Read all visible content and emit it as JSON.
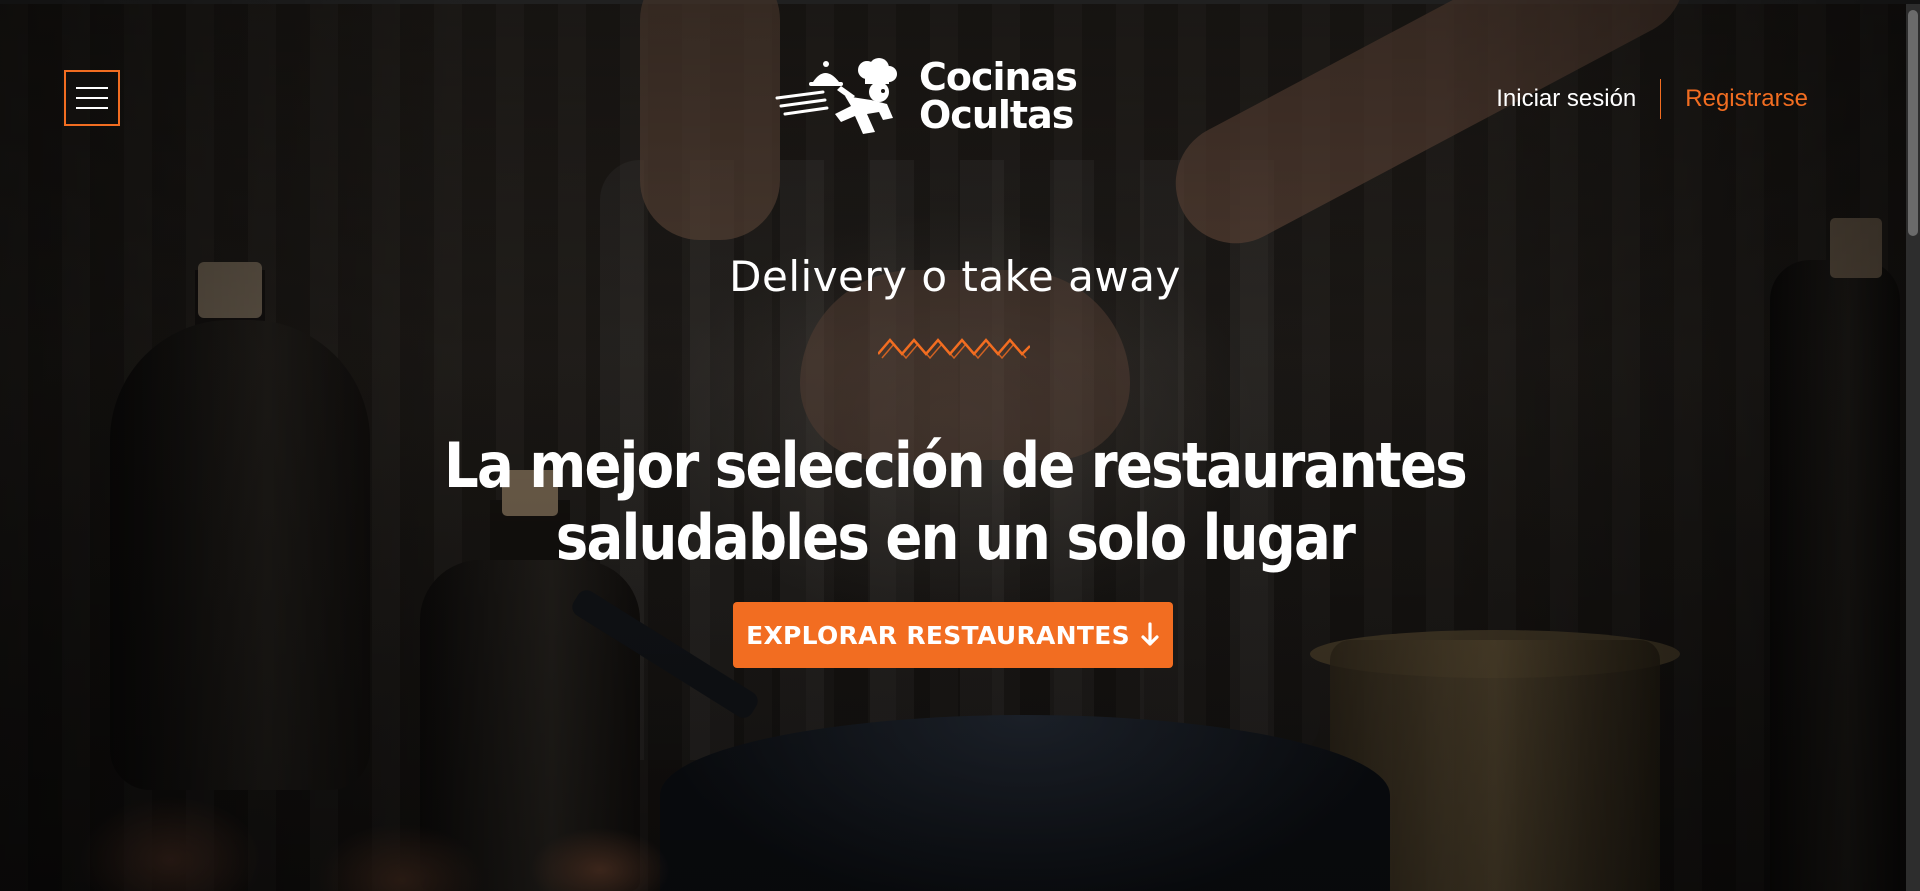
{
  "header": {
    "menu_icon": "hamburger-menu-icon",
    "logo": {
      "line1": "Cocinas",
      "line2": "Ocultas",
      "icon": "running-chef-with-cloche-icon"
    },
    "login_label": "Iniciar sesión",
    "register_label": "Registrarse"
  },
  "hero": {
    "subtitle": "Delivery o take away",
    "headline_line1": "La mejor selección de restaurantes",
    "headline_line2": "saludables en un solo lugar",
    "cta_label": "EXPLORAR RESTAURANTES",
    "cta_icon": "arrow-down-icon",
    "divider_icon": "zigzag-divider-icon"
  },
  "colors": {
    "accent": "#f26d21",
    "text": "#ffffff",
    "background": "#1a1714"
  }
}
